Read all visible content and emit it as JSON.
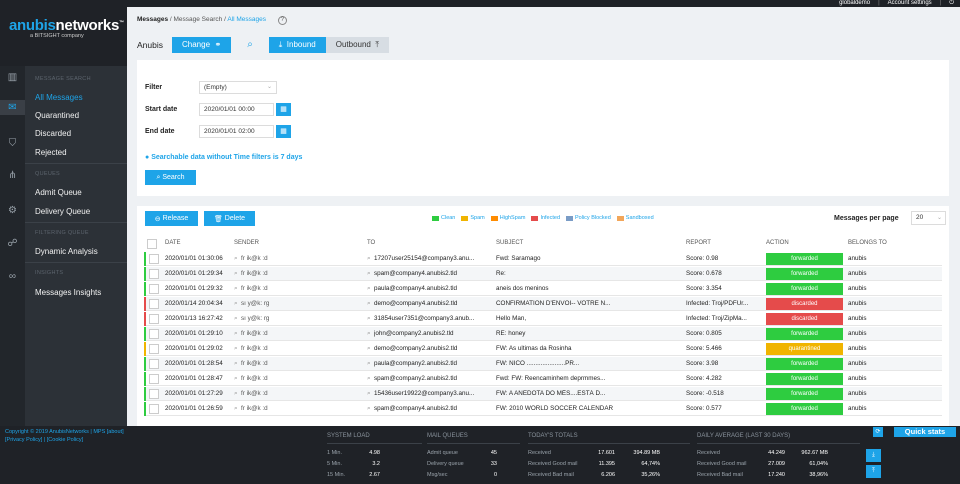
{
  "topbar": {
    "user": "globaldemo",
    "account_settings": "Account settings",
    "logout_icon": "power-icon"
  },
  "logo": {
    "brand_a": "anubis",
    "brand_b": "networks",
    "tm": "™",
    "sub": "a BITSIGHT company"
  },
  "rail": {
    "icons": [
      "chart-bars-icon",
      "mail-icon",
      "shield-icon",
      "nodes-icon",
      "gear-icon",
      "sitemap-icon",
      "link-icon"
    ]
  },
  "sidenav": {
    "sec_message_search": "MESSAGE SEARCH",
    "all_messages": "All Messages",
    "quarantined": "Quarantined",
    "discarded": "Discarded",
    "rejected": "Rejected",
    "sec_queues": "QUEUES",
    "admit_queue": "Admit Queue",
    "delivery_queue": "Delivery Queue",
    "sec_filtering_queue": "FILTERING QUEUE",
    "dynamic_analysis": "Dynamic Analysis",
    "sec_insights": "INSIGHTS",
    "messages_insights": "Messages Insights"
  },
  "breadcrumb": {
    "a": "Messages",
    "sep1": " / ",
    "b": "Message Search",
    "sep2": " / ",
    "c": "All Messages",
    "help": "?"
  },
  "toolbar": {
    "tenant": "Anubis",
    "change": "Change",
    "inbound": "Inbound",
    "outbound": "Outbound"
  },
  "filter": {
    "filter_label": "Filter",
    "filter_value": "(Empty)",
    "start_label": "Start date",
    "start_value": "2020/01/01 00:00",
    "end_label": "End date",
    "end_value": "2020/01/01 02:00",
    "info": "Searchable data without Time filters is 7 days",
    "search": "Search"
  },
  "results": {
    "release": "Release",
    "delete": "Delete",
    "legend": [
      {
        "label": "Clean",
        "color": "#2ecc40"
      },
      {
        "label": "Spam",
        "color": "#f0b400"
      },
      {
        "label": "HighSpam",
        "color": "#ff8c00"
      },
      {
        "label": "Infected",
        "color": "#e54b4b"
      },
      {
        "label": "Policy Blocked",
        "color": "#7a9cc6"
      },
      {
        "label": "Sandboxed",
        "color": "#f2a65a"
      }
    ],
    "messages_per_page_label": "Messages per page",
    "messages_per_page": "20",
    "columns": [
      "DATE",
      "SENDER",
      "TO",
      "SUBJECT",
      "REPORT",
      "ACTION",
      "BELONGS TO"
    ],
    "rows": [
      {
        "status": "#2ecc40",
        "date": "2020/01/01 01:30:06",
        "sender": "fr  ik@k         :d",
        "to": "17207user25154@company3.anu...",
        "subject": "Fwd: Saramago",
        "report": "Score: 0.98",
        "action": "forwarded",
        "action_color": "#2ecc40",
        "belongs": "anubis"
      },
      {
        "status": "#2ecc40",
        "date": "2020/01/01 01:29:34",
        "sender": "fr  ik@k         :d",
        "to": "spam@company4.anubis2.tld",
        "subject": "Re:",
        "report": "Score: 0.678",
        "action": "forwarded",
        "action_color": "#2ecc40",
        "belongs": "anubis"
      },
      {
        "status": "#2ecc40",
        "date": "2020/01/01 01:29:32",
        "sender": "fr  ik@k         :d",
        "to": "paula@company4.anubis2.tld",
        "subject": "aneis dos meninos",
        "report": "Score: 3.354",
        "action": "forwarded",
        "action_color": "#2ecc40",
        "belongs": "anubis"
      },
      {
        "status": "#e54b4b",
        "date": "2020/01/14 20:04:34",
        "sender": "sı  y@k:         rg",
        "to": "demo@company4.anubis2.tld",
        "subject": "CONFIRMATION D'ENVOI-- VOTRE N...",
        "report": "Infected: Troj/PDFUr...",
        "action": "discarded",
        "action_color": "#e54b4b",
        "belongs": "anubis"
      },
      {
        "status": "#e54b4b",
        "date": "2020/01/13 16:27:42",
        "sender": "sı  y@k:         rg",
        "to": "31854user7351@company3.anub...",
        "subject": "Hello Man,",
        "report": "Infected: Troj/ZipMa...",
        "action": "discarded",
        "action_color": "#e54b4b",
        "belongs": "anubis"
      },
      {
        "status": "#2ecc40",
        "date": "2020/01/01 01:29:10",
        "sender": "fr  ik@k         :d",
        "to": "john@company2.anubis2.tld",
        "subject": "RE: honey",
        "report": "Score: 0.805",
        "action": "forwarded",
        "action_color": "#2ecc40",
        "belongs": "anubis"
      },
      {
        "status": "#f0b400",
        "date": "2020/01/01 01:29:02",
        "sender": "fr  ik@k         :d",
        "to": "demo@company2.anubis2.tld",
        "subject": "FW: As ultimas da Rosinha",
        "report": "Score: 5.466",
        "action": "quarantined",
        "action_color": "#f0b400",
        "belongs": "anubis"
      },
      {
        "status": "#2ecc40",
        "date": "2020/01/01 01:28:54",
        "sender": "fr  ik@k         :d",
        "to": "paula@company2.anubis2.tld",
        "subject": "FW: NICO ......................PR...",
        "report": "Score: 3.98",
        "action": "forwarded",
        "action_color": "#2ecc40",
        "belongs": "anubis"
      },
      {
        "status": "#2ecc40",
        "date": "2020/01/01 01:28:47",
        "sender": "fr  ik@k         :d",
        "to": "spam@company2.anubis2.tld",
        "subject": "Fwd: FW: Reencaminhem deprmmes...",
        "report": "Score: 4.282",
        "action": "forwarded",
        "action_color": "#2ecc40",
        "belongs": "anubis"
      },
      {
        "status": "#2ecc40",
        "date": "2020/01/01 01:27:29",
        "sender": "fr  ik@k         :d",
        "to": "15436user19922@company3.anu...",
        "subject": "FW: A ANEDOTA DO MÊS....ESTÁ D...",
        "report": "Score: -0.518",
        "action": "forwarded",
        "action_color": "#2ecc40",
        "belongs": "anubis"
      },
      {
        "status": "#2ecc40",
        "date": "2020/01/01 01:26:59",
        "sender": "fr  ik@k         :d",
        "to": "spam@company4.anubis2.tld",
        "subject": "FW: 2010 WORLD SOCCER CALENDAR",
        "report": "Score: 0.577",
        "action": "forwarded",
        "action_color": "#2ecc40",
        "belongs": "anubis"
      }
    ]
  },
  "footer": {
    "copyright": "Copyright © 2019 AnubisNetworks | MPS [about]",
    "links": "[Privacy Policy] | [Cookie Policy]",
    "quick_stats": "Quick stats",
    "system_load": {
      "title": "SYSTEM LOAD",
      "rows": [
        [
          "1 Min.",
          "4.98"
        ],
        [
          "5 Min.",
          "3.2"
        ],
        [
          "15 Min.",
          "2.67"
        ]
      ]
    },
    "mail_queues": {
      "title": "MAIL QUEUES",
      "rows": [
        [
          "Admit queue",
          "45"
        ],
        [
          "Delivery queue",
          "33"
        ],
        [
          "Msg/sec",
          "0"
        ]
      ]
    },
    "todays_totals": {
      "title": "TODAY'S TOTALS",
      "rows": [
        [
          "Received",
          "17.601",
          "394.89 MB"
        ],
        [
          "Received Good mail",
          "11.395",
          "64,74%"
        ],
        [
          "Received Bad mail",
          "6.206",
          "35,26%"
        ]
      ]
    },
    "daily_average": {
      "title": "DAILY AVERAGE (LAST 30 DAYS)",
      "rows": [
        [
          "Received",
          "44.249",
          "962.67 MB"
        ],
        [
          "Received Good mail",
          "27.009",
          "61,04%"
        ],
        [
          "Received Bad mail",
          "17.240",
          "38,96%"
        ]
      ]
    }
  }
}
